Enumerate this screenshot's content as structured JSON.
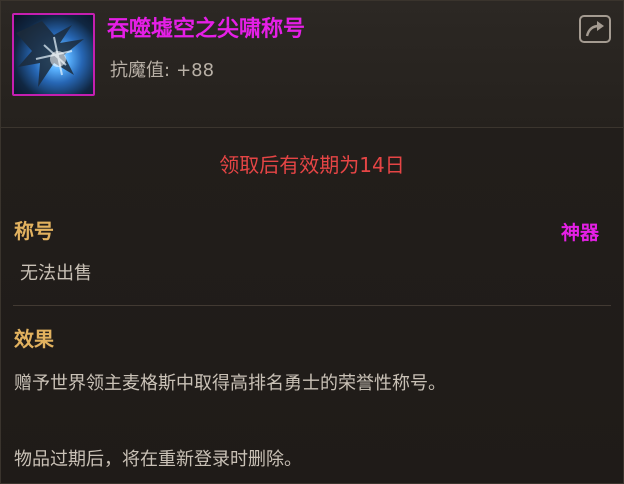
{
  "item": {
    "name": "吞噬墟空之尖啸称号",
    "stat_label": "抗魔值:",
    "stat_value": "+88",
    "icon": "dragon-icon",
    "rarity_color": "#e51fe6",
    "share_icon": "share-icon"
  },
  "expiry": "领取后有效期为14日",
  "category": {
    "label": "称号",
    "grade": "神器",
    "trade": "无法出售"
  },
  "effect": {
    "label": "效果",
    "description": "赠予世界领主麦格斯中取得高排名勇士的荣誉性称号。",
    "note": "物品过期后，将在重新登录时删除。"
  },
  "colors": {
    "section_title": "#e2b25f",
    "expiry": "#e64545",
    "text": "#c9c1b6"
  }
}
